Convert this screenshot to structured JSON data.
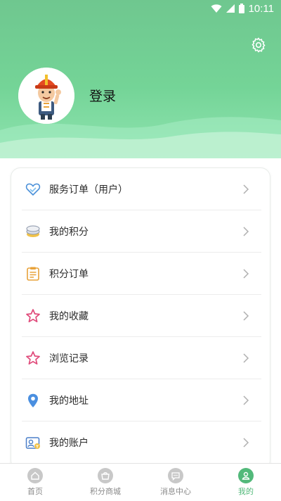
{
  "status_bar": {
    "time": "10:11"
  },
  "header": {
    "login_label": "登录"
  },
  "menu": [
    {
      "label": "服务订单（用户）",
      "icon": "heart-tag-icon"
    },
    {
      "label": "我的积分",
      "icon": "coins-icon"
    },
    {
      "label": "积分订单",
      "icon": "clipboard-icon"
    },
    {
      "label": "我的收藏",
      "icon": "star-icon"
    },
    {
      "label": "浏览记录",
      "icon": "star-icon"
    },
    {
      "label": "我的地址",
      "icon": "location-pin-icon"
    },
    {
      "label": "我的账户",
      "icon": "account-icon"
    }
  ],
  "bottom_nav": [
    {
      "label": "首页",
      "icon": "home-icon",
      "active": false
    },
    {
      "label": "积分商城",
      "icon": "store-icon",
      "active": false
    },
    {
      "label": "消息中心",
      "icon": "message-icon",
      "active": false
    },
    {
      "label": "我的",
      "icon": "user-icon",
      "active": true
    }
  ],
  "colors": {
    "brand": "#6fc78f",
    "active_tab": "#52b97a",
    "inactive_tab": "#c8c8c8"
  }
}
